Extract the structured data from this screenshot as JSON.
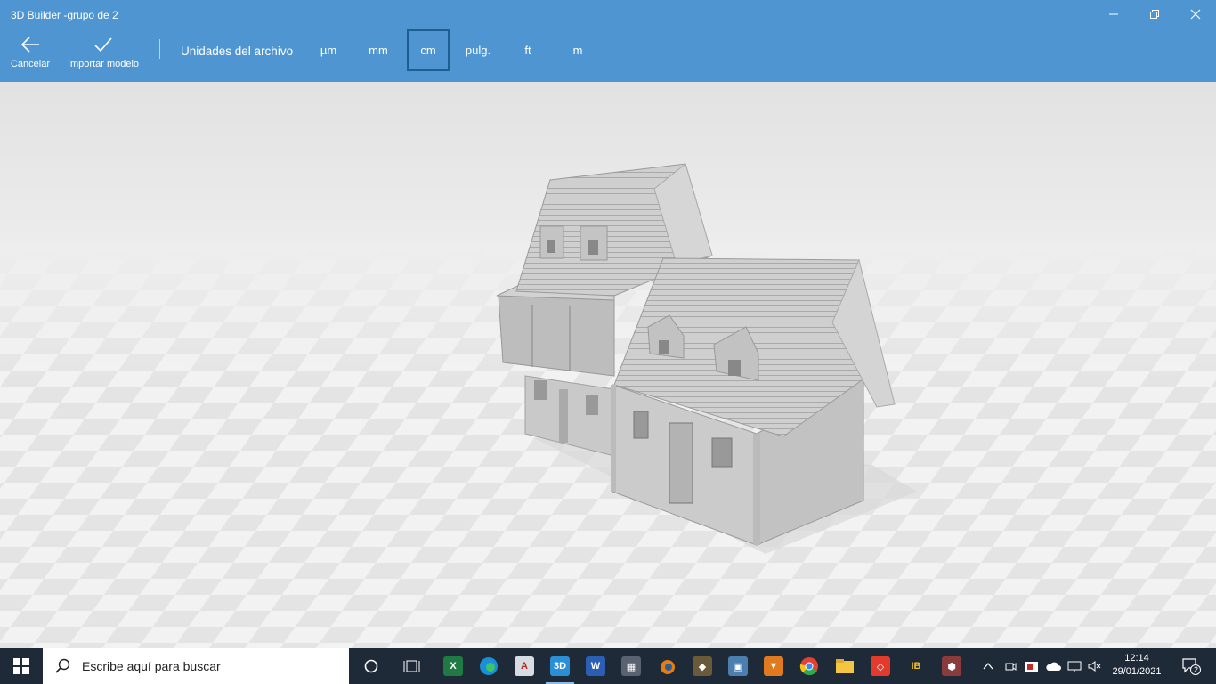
{
  "window": {
    "title": "3D Builder -grupo de 2"
  },
  "toolbar": {
    "cancel_label": "Cancelar",
    "import_label": "Importar modelo",
    "units_label": "Unidades del archivo",
    "units": [
      "µm",
      "mm",
      "cm",
      "pulg.",
      "ft",
      "m"
    ],
    "selected_unit": "cm"
  },
  "taskbar": {
    "search_placeholder": "Escribe aquí para buscar",
    "apps": [
      "cortana-icon",
      "task-view-icon",
      "excel-icon",
      "edge-icon",
      "acrobat-icon",
      "3d-builder-icon",
      "word-icon",
      "calculator-icon",
      "blender-icon",
      "paint3d-icon",
      "app-icon",
      "shield-app-icon",
      "chrome-icon",
      "file-explorer-icon",
      "anydesk-icon",
      "bb-app-icon",
      "cube-app-icon"
    ],
    "time": "12:14",
    "date": "29/01/2021",
    "notifications": "2"
  },
  "colors": {
    "accent": "#4f95d1",
    "taskbar": "#1f2a38"
  }
}
